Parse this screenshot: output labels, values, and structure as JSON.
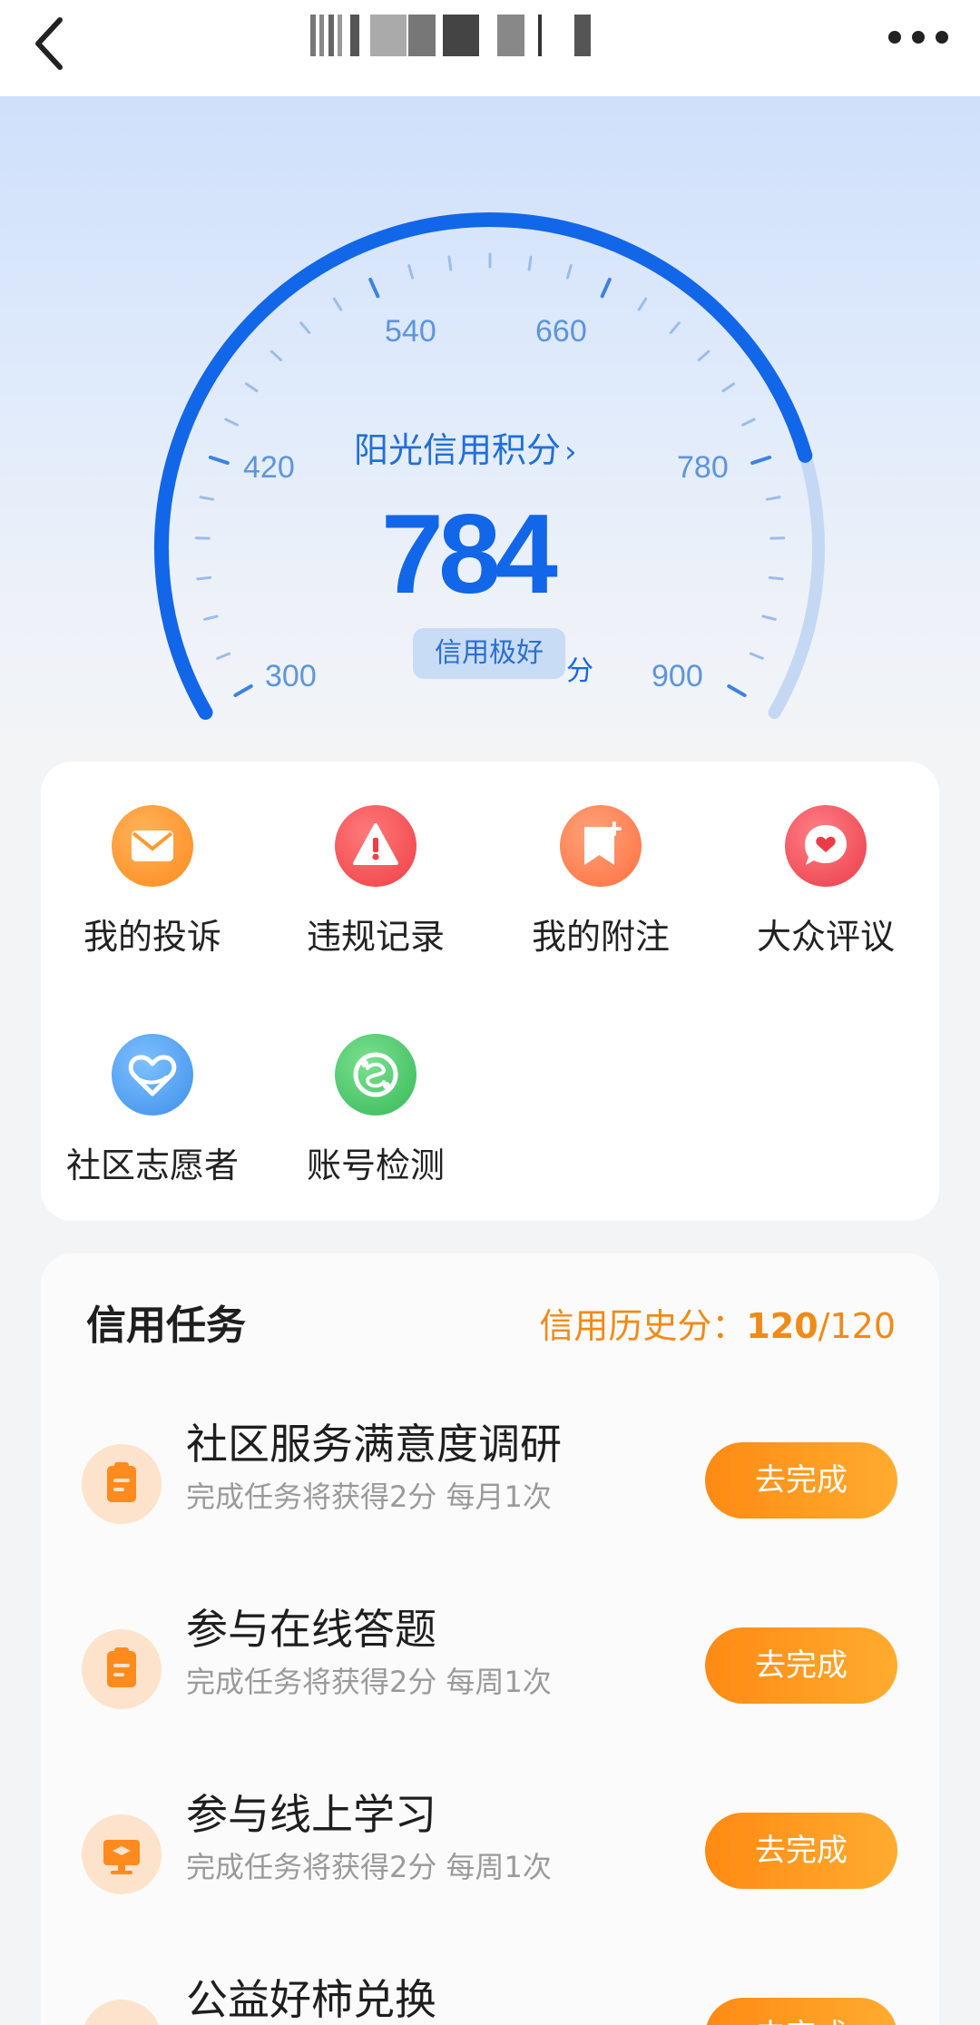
{
  "nav": {
    "back_icon": "chevron-left-icon",
    "more_icon": "more-dots-icon"
  },
  "score": {
    "title": "阳光信用积分",
    "title_chevron": "›",
    "value": "784",
    "unit": "分",
    "level": "信用极好",
    "scale_min": 300,
    "scale_max": 900,
    "ticks": [
      "300",
      "420",
      "540",
      "660",
      "780",
      "900"
    ],
    "progress_fraction": 0.8067,
    "accent_color": "#1266e8"
  },
  "services": [
    {
      "label": "我的投诉",
      "icon": "mail-icon",
      "color": "#ff9a2e"
    },
    {
      "label": "违规记录",
      "icon": "warning-icon",
      "color": "#f25555"
    },
    {
      "label": "我的附注",
      "icon": "bookmark-plus-icon",
      "color": "#ff8552"
    },
    {
      "label": "大众评议",
      "icon": "heart-chat-icon",
      "color": "#f0505a"
    },
    {
      "label": "社区志愿者",
      "icon": "heart-outline-icon",
      "color": "#4f9ff0"
    },
    {
      "label": "账号检测",
      "icon": "scan-check-icon",
      "color": "#45c26a"
    }
  ],
  "tasks": {
    "title": "信用任务",
    "history_label": "信用历史分：",
    "history_value": "120",
    "history_total": "/120",
    "items": [
      {
        "name": "社区服务满意度调研",
        "desc": "完成任务将获得2分 每月1次",
        "button": "去完成",
        "icon": "clipboard-icon"
      },
      {
        "name": "参与在线答题",
        "desc": "完成任务将获得2分 每周1次",
        "button": "去完成",
        "icon": "clipboard-icon"
      },
      {
        "name": "参与线上学习",
        "desc": "完成任务将获得2分 每周1次",
        "button": "去完成",
        "icon": "graduation-screen-icon"
      },
      {
        "name": "公益好柿兑换",
        "desc": "",
        "button": "去完成",
        "icon": "gift-icon"
      }
    ]
  }
}
